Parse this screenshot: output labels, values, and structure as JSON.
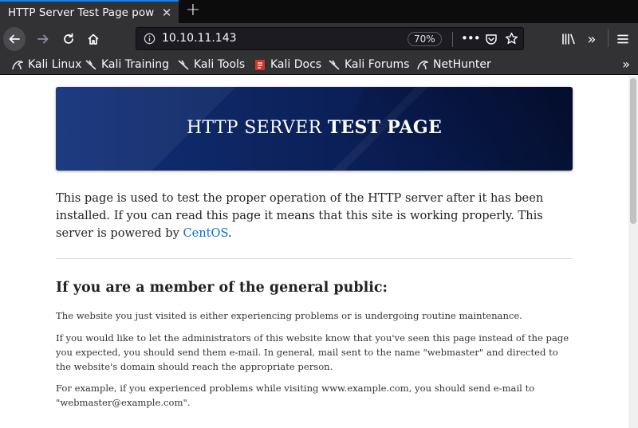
{
  "browser": {
    "tab": {
      "title": "HTTP Server Test Page pow"
    },
    "url": "10.10.11.143",
    "zoom": "70%",
    "bookmarks": [
      {
        "label": "Kali Linux",
        "icon": "kali-dragon-icon"
      },
      {
        "label": "Kali Training",
        "icon": "kali-dragon-icon"
      },
      {
        "label": "Kali Tools",
        "icon": "kali-dragon-icon"
      },
      {
        "label": "Kali Docs",
        "icon": "kali-docs-icon"
      },
      {
        "label": "Kali Forums",
        "icon": "kali-dragon-icon"
      },
      {
        "label": "NetHunter",
        "icon": "kali-dragon-icon"
      }
    ]
  },
  "page": {
    "banner": {
      "title_light": "HTTP SERVER ",
      "title_bold": "TEST PAGE"
    },
    "intro": {
      "text": "This page is used to test the proper operation of the HTTP server after it has been installed. If you can read this page it means that this site is working properly. This server is powered by ",
      "link": "CentOS",
      "end": "."
    },
    "section_public": {
      "heading": "If you are a member of the general public:",
      "p1": "The website you just visited is either experiencing problems or is undergoing routine maintenance.",
      "p2": "If you would like to let the administrators of this website know that you've seen this page instead of the page you expected, you should send them e-mail. In general, mail sent to the name \"webmaster\" and directed to the website's domain should reach the appropriate person.",
      "p3": "For example, if you experienced problems while visiting www.example.com, you should send e-mail to \"webmaster@example.com\"."
    }
  },
  "colors": {
    "accent": "#0a84ff",
    "chrome": "#323234",
    "link": "#0a6ee0"
  }
}
